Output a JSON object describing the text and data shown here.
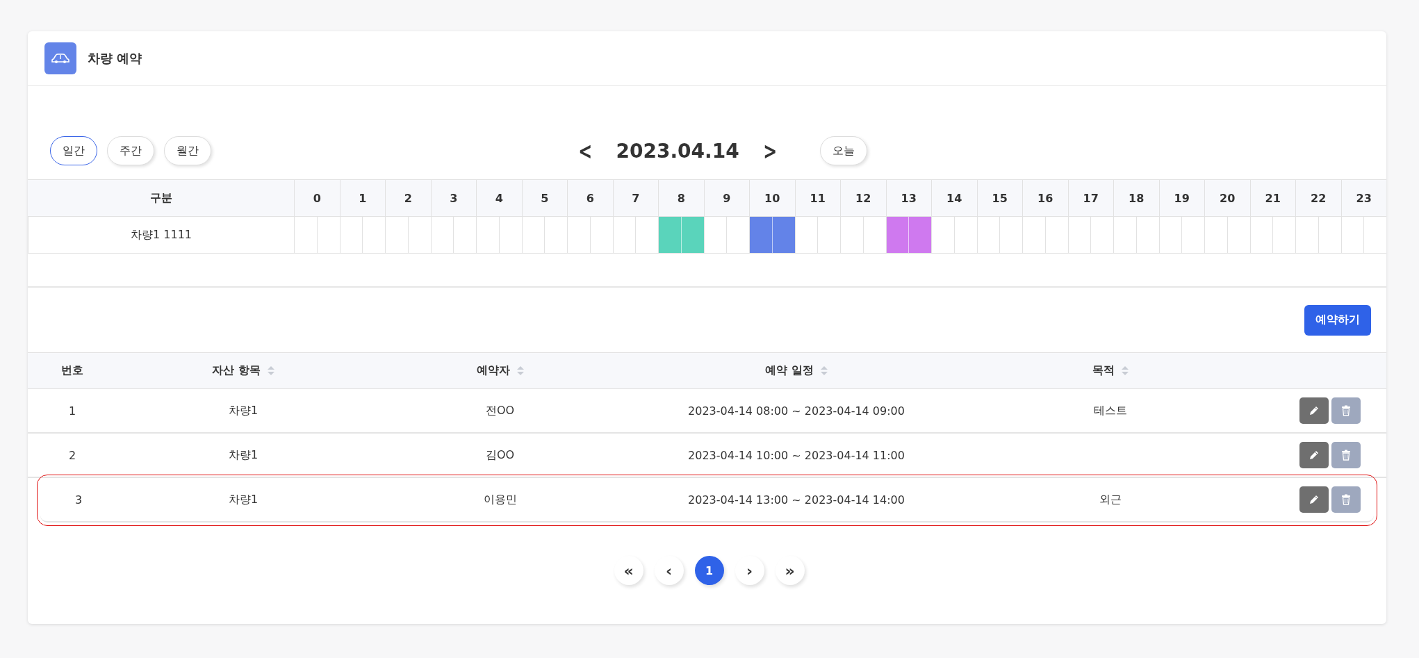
{
  "header": {
    "title": "차량 예약"
  },
  "views": [
    {
      "label": "일간",
      "selected": true
    },
    {
      "label": "주간",
      "selected": false
    },
    {
      "label": "월간",
      "selected": false
    }
  ],
  "date_nav": {
    "prev": "<",
    "date": "2023.04.14",
    "next": ">",
    "today": "오늘"
  },
  "timeline": {
    "label_column": "구분",
    "hours": [
      "0",
      "1",
      "2",
      "3",
      "4",
      "5",
      "6",
      "7",
      "8",
      "9",
      "10",
      "11",
      "12",
      "13",
      "14",
      "15",
      "16",
      "17",
      "18",
      "19",
      "20",
      "21",
      "22",
      "23"
    ],
    "rows": [
      {
        "name": "차량1 1111",
        "cells": [
          {
            "booked": false
          },
          {
            "booked": false
          },
          {
            "booked": false
          },
          {
            "booked": false
          },
          {
            "booked": false
          },
          {
            "booked": false
          },
          {
            "booked": false
          },
          {
            "booked": false
          },
          {
            "booked": true,
            "color": "#5ad4bb"
          },
          {
            "booked": false
          },
          {
            "booked": true,
            "color": "#6383e8"
          },
          {
            "booked": false
          },
          {
            "booked": false
          },
          {
            "booked": true,
            "color": "#cf79ef"
          },
          {
            "booked": false
          },
          {
            "booked": false
          },
          {
            "booked": false
          },
          {
            "booked": false
          },
          {
            "booked": false
          },
          {
            "booked": false
          },
          {
            "booked": false
          },
          {
            "booked": false
          },
          {
            "booked": false
          },
          {
            "booked": false
          }
        ]
      }
    ]
  },
  "reserve_button": "예약하기",
  "table": {
    "columns": [
      {
        "label": "번호",
        "sortable": false
      },
      {
        "label": "자산 항목",
        "sortable": true
      },
      {
        "label": "예약자",
        "sortable": true
      },
      {
        "label": "예약 일정",
        "sortable": true
      },
      {
        "label": "목적",
        "sortable": true
      }
    ],
    "rows": [
      {
        "number": "1",
        "asset": "차량1",
        "reserver": "전OO",
        "schedule": "2023-04-14 08:00 ~ 2023-04-14 09:00",
        "purpose": "테스트",
        "selected": false
      },
      {
        "number": "2",
        "asset": "차량1",
        "reserver": "김OO",
        "schedule": "2023-04-14 10:00 ~ 2023-04-14 11:00",
        "selected": false
      },
      {
        "number": "3",
        "asset": "차량1",
        "reserver": "이용민",
        "schedule": "2023-04-14 13:00 ~ 2023-04-14 14:00",
        "purpose": "외근",
        "selected": true
      }
    ]
  },
  "pagination": [
    {
      "label": "«",
      "kind": "first"
    },
    {
      "label": "‹",
      "kind": "prev"
    },
    {
      "label": "1",
      "kind": "page",
      "selected": true
    },
    {
      "label": "›",
      "kind": "next"
    },
    {
      "label": "»",
      "kind": "last"
    }
  ]
}
